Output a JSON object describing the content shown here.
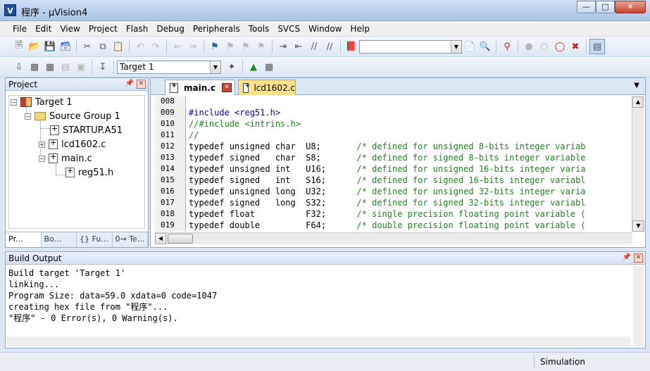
{
  "window": {
    "title": "程序 - µVision4",
    "app_icon_glyph": "V",
    "controls": [
      "minimize",
      "maximize",
      "close"
    ]
  },
  "menu": [
    "File",
    "Edit",
    "View",
    "Project",
    "Flash",
    "Debug",
    "Peripherals",
    "Tools",
    "SVCS",
    "Window",
    "Help"
  ],
  "toolbar2": {
    "target_select": "Target 1"
  },
  "project_panel": {
    "title": "Project",
    "tree": {
      "target": "Target 1",
      "group": "Source Group 1",
      "files": [
        "STARTUP.A51",
        "lcd1602.c",
        "main.c"
      ],
      "include": "reg51.h"
    },
    "tabs": [
      "Pr...",
      "Bo...",
      "{} Fu...",
      "0→ Te..."
    ]
  },
  "editor": {
    "tabs": [
      {
        "name": "main.c",
        "active": true
      },
      {
        "name": "lcd1602.c",
        "active": false
      }
    ],
    "lines": [
      {
        "num": "008",
        "code": "",
        "comment": ""
      },
      {
        "num": "009",
        "code": "#include <reg51.h>",
        "comment": ""
      },
      {
        "num": "010",
        "code": "",
        "comment": "//#include <intrins.h>"
      },
      {
        "num": "011",
        "code": "",
        "comment": "//"
      },
      {
        "num": "012",
        "code": "typedef unsigned char  U8;       ",
        "comment": "/* defined for unsigned 8-bits integer variab"
      },
      {
        "num": "013",
        "code": "typedef signed   char  S8;       ",
        "comment": "/* defined for signed 8-bits integer variable"
      },
      {
        "num": "014",
        "code": "typedef unsigned int   U16;      ",
        "comment": "/* defined for unsigned 16-bits integer varia"
      },
      {
        "num": "015",
        "code": "typedef signed   int   S16;      ",
        "comment": "/* defined for signed 16-bits integer variabl"
      },
      {
        "num": "016",
        "code": "typedef unsigned long  U32;      ",
        "comment": "/* defined for unsigned 32-bits integer varia"
      },
      {
        "num": "017",
        "code": "typedef signed   long  S32;      ",
        "comment": "/* defined for signed 32-bits integer variabl"
      },
      {
        "num": "018",
        "code": "typedef float          F32;      ",
        "comment": "/* single precision floating point variable ("
      },
      {
        "num": "019",
        "code": "typedef double         F64;      ",
        "comment": "/* double precision floating point variable ("
      }
    ]
  },
  "build_output": {
    "title": "Build Output",
    "lines": [
      "Build target 'Target 1'",
      "linking...",
      "Program Size: data=59.0 xdata=0 code=1047",
      "creating hex file from \"程序\"...",
      "\"程序\" - 0 Error(s), 0 Warning(s)."
    ]
  },
  "status": {
    "mode": "Simulation"
  }
}
